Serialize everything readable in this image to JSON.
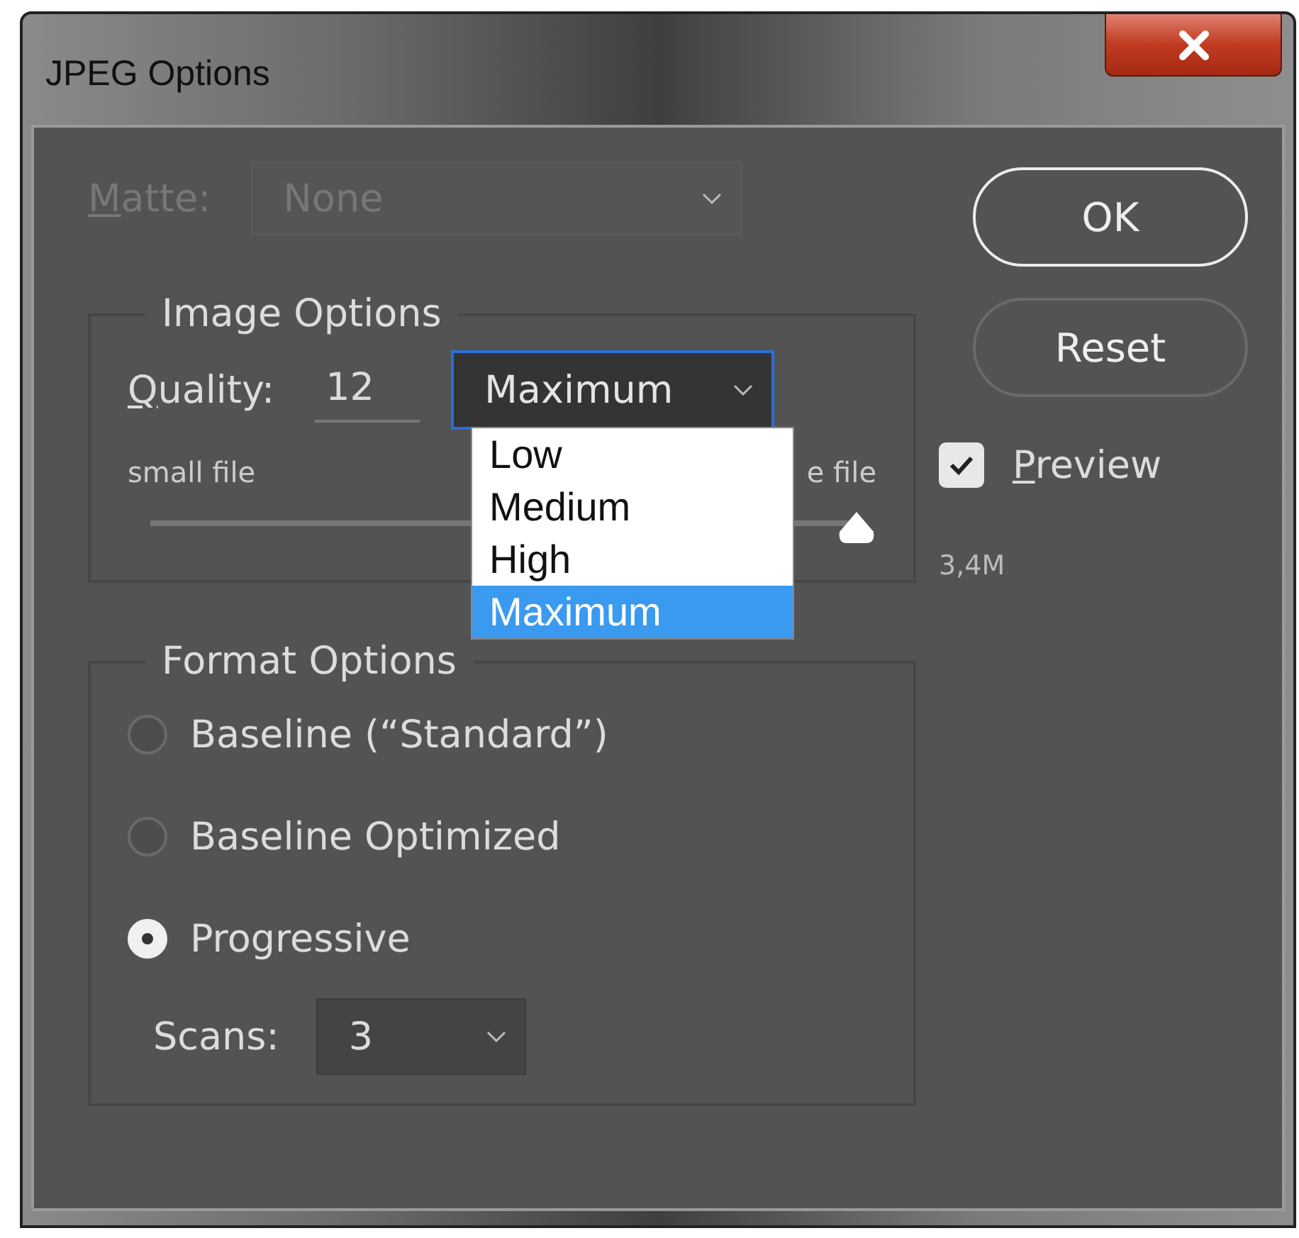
{
  "window": {
    "title": "JPEG Options"
  },
  "matte": {
    "label": "Matte:",
    "value": "None",
    "disabled": true
  },
  "image_options": {
    "title": "Image Options",
    "quality_label": "Quality:",
    "quality_value": "12",
    "quality_preset": "Maximum",
    "preset_menu": [
      {
        "label": "Low",
        "selected": false
      },
      {
        "label": "Medium",
        "selected": false
      },
      {
        "label": "High",
        "selected": false
      },
      {
        "label": "Maximum",
        "selected": true
      }
    ],
    "slider": {
      "left_label": "small file",
      "right_label": "e file",
      "level": 1
    }
  },
  "format_options": {
    "title": "Format Options",
    "radios": [
      {
        "label": "Baseline (“Standard”)",
        "selected": false
      },
      {
        "label": "Baseline Optimized",
        "selected": false
      },
      {
        "label": "Progressive",
        "selected": true
      }
    ],
    "scans_label": "Scans:",
    "scans_value": "3"
  },
  "buttons": [
    "OK",
    "Reset"
  ],
  "preview": {
    "label": "Preview",
    "checked": true
  },
  "file_size": "3,4M"
}
